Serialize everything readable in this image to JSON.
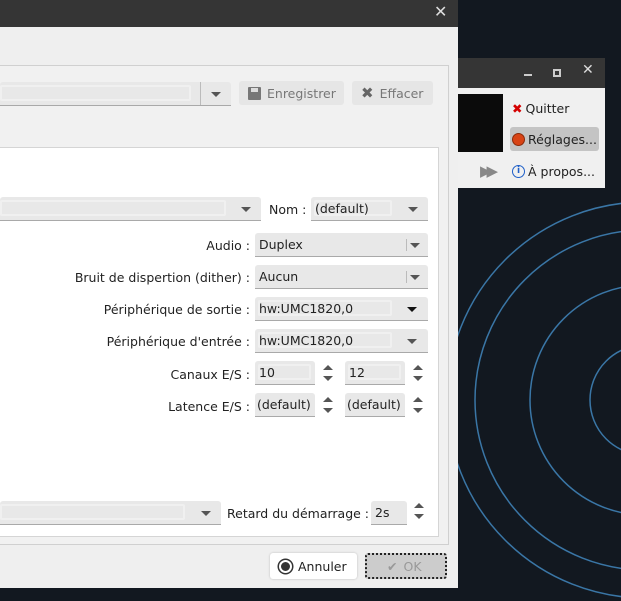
{
  "dialog": {
    "close_icon": "close-icon",
    "save_label": "Enregistrer",
    "clear_label": "Effacer",
    "name_label": "Nom :",
    "name_value": "(default)",
    "rows": [
      {
        "label": "Audio :",
        "value": "Duplex"
      },
      {
        "label": "Bruit de dispertion (dither) :",
        "value": "Aucun"
      },
      {
        "label": "Périphérique de sortie :",
        "value": "hw:UMC1820,0"
      },
      {
        "label": "Périphérique d'entrée :",
        "value": "hw:UMC1820,0"
      }
    ],
    "channels_label": "Canaux E/S :",
    "channels_in": "10",
    "channels_out": "12",
    "latency_label": "Latence E/S :",
    "latency_in": "(default)",
    "latency_out": "(default)",
    "delay_label": "Retard du démarrage :",
    "delay_value": "2s",
    "cancel_label": "Annuler",
    "ok_label": "OK"
  },
  "mini_window": {
    "quit_label": "Quitter",
    "settings_label": "Réglages...",
    "about_label": "À propos...",
    "quit_color": "#d40000",
    "settings_color": "#d84315",
    "about_color": "#1e5fc8"
  }
}
